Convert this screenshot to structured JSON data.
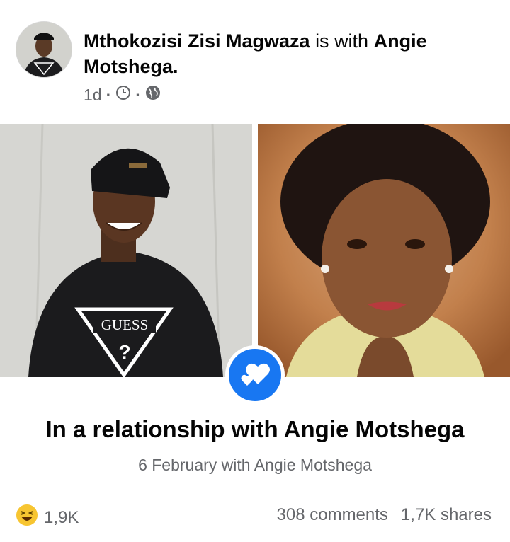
{
  "post": {
    "author_name": "Mthokozisi Zisi Magwaza",
    "with_text": "is with",
    "tagged_name": "Angie Motshega.",
    "time": "1d",
    "separator": "·"
  },
  "life_event": {
    "title": "In a relationship with Angie Motshega",
    "subtitle": "6 February with Angie Motshega"
  },
  "stats": {
    "reactions": "1,9K",
    "comments": "308 comments",
    "shares": "1,7K shares"
  },
  "icons": {
    "clock": "clock-icon",
    "globe": "globe-icon",
    "hearts": "hearts-icon",
    "reaction": "laughing-emoji-icon"
  },
  "colors": {
    "accent": "#1877f2",
    "secondary_text": "#65676b"
  }
}
